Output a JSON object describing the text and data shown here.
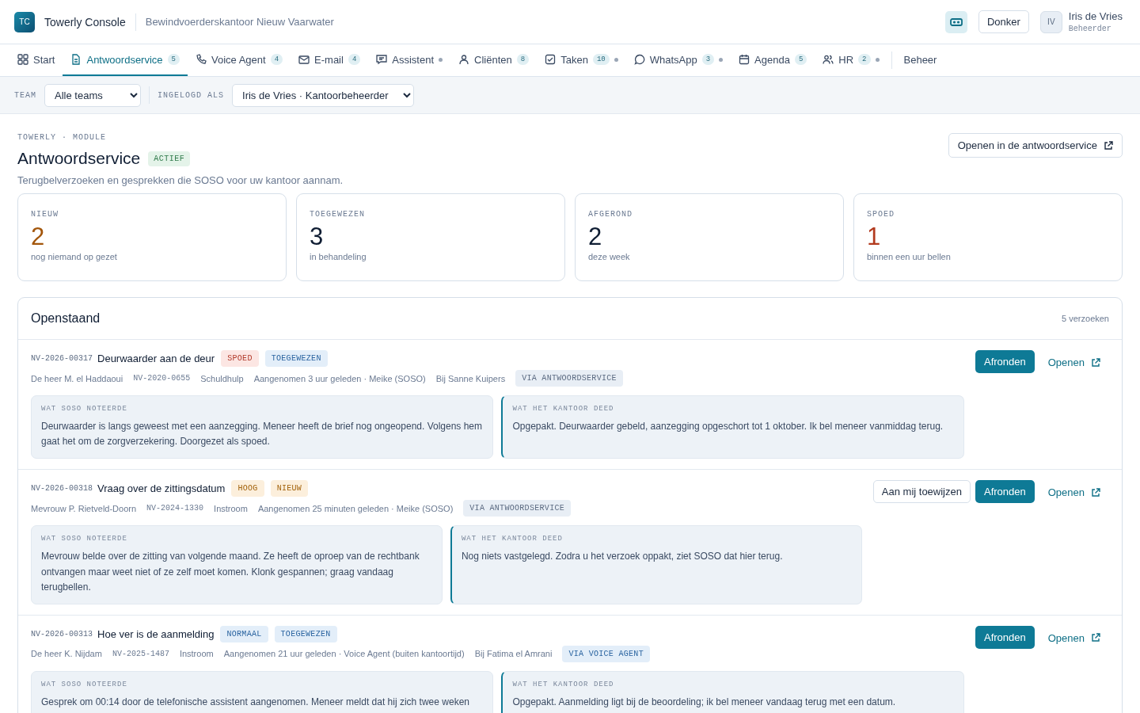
{
  "app": {
    "logo": "TC",
    "name": "Towerly Console",
    "office": "Bewindvoerderskantoor Nieuw Vaarwater",
    "theme_button": "Donker",
    "user": {
      "initials": "IV",
      "name": "Iris de Vries",
      "role": "Beheerder"
    }
  },
  "tabs": [
    {
      "label": "Start",
      "selected": false
    },
    {
      "label": "Antwoordservice",
      "badge": "5",
      "selected": true
    },
    {
      "label": "Voice Agent",
      "badge": "4",
      "selected": false
    },
    {
      "label": "E-mail",
      "badge": "4",
      "selected": false
    },
    {
      "label": "Assistent",
      "dot": true,
      "selected": false
    },
    {
      "label": "Cliënten",
      "badge": "8",
      "selected": false
    },
    {
      "label": "Taken",
      "badge": "10",
      "dot": true,
      "selected": false
    },
    {
      "label": "WhatsApp",
      "badge": "3",
      "dot": true,
      "selected": false
    },
    {
      "label": "Agenda",
      "badge": "5",
      "selected": false
    },
    {
      "label": "HR",
      "badge": "2",
      "dot": true,
      "selected": false
    }
  ],
  "admin_tab": "Beheer",
  "filters": [
    {
      "label": "TEAM",
      "value": "Alle teams"
    },
    {
      "label": "INGELOGD ALS",
      "value": "Iris de Vries · Kantoorbeheerder"
    }
  ],
  "page": {
    "eyebrow": "TOWERLY · MODULE",
    "title": "Antwoordservice",
    "status": "ACTIEF",
    "subtitle": "Terugbelverzoeken en gesprekken die SOSO voor uw kantoor aannam.",
    "open_button": "Openen in de antwoordservice"
  },
  "stats": [
    {
      "label": "NIEUW",
      "value": "2",
      "note": "nog niemand op gezet",
      "kind": "warning"
    },
    {
      "label": "TOEGEWEZEN",
      "value": "3",
      "note": "in behandeling",
      "kind": "plain"
    },
    {
      "label": "AFGEROND",
      "value": "2",
      "note": "deze week",
      "kind": "plain"
    },
    {
      "label": "SPOED",
      "value": "1",
      "note": "binnen een uur bellen",
      "kind": "danger"
    }
  ],
  "list": {
    "title": "Openstaand",
    "count": "5 verzoeken",
    "requests": [
      {
        "ref": "NV-2026-00317",
        "title": "Deurwaarder aan de deur",
        "tags": [
          {
            "text": "SPOED",
            "kind": "urgent"
          },
          {
            "text": "TOEGEWEZEN",
            "kind": "assigned"
          }
        ],
        "client": "De heer M. el Haddaoui",
        "dossier": "NV-2020-0655",
        "category": "Schuldhulp",
        "received": "Aangenomen 3 uur geleden · Meike (SOSO)",
        "handler": "Bij Sanne Kuipers",
        "source": {
          "text": "VIA ANTWOORDSERVICE",
          "kind": "service"
        },
        "actions": [
          "Afronden",
          "Openen"
        ],
        "notes": [
          {
            "label": "WAT SOSO NOTEERDE",
            "text": "Deurwaarder is langs geweest met een aanzegging. Meneer heeft de brief nog ongeopend. Volgens hem gaat het om de zorgverzekering. Doorgezet als spoed."
          },
          {
            "label": "WAT HET KANTOOR DEED",
            "text": "Opgepakt. Deurwaarder gebeld, aanzegging opgeschort tot 1 oktober. Ik bel meneer vanmiddag terug."
          }
        ]
      },
      {
        "ref": "NV-2026-00318",
        "title": "Vraag over de zittingsdatum",
        "tags": [
          {
            "text": "HOOG",
            "kind": "high"
          },
          {
            "text": "NIEUW",
            "kind": "new"
          }
        ],
        "client": "Mevrouw P. Rietveld-Doorn",
        "dossier": "NV-2024-1330",
        "category": "Instroom",
        "received": "Aangenomen 25 minuten geleden · Meike (SOSO)",
        "source": {
          "text": "VIA ANTWOORDSERVICE",
          "kind": "service"
        },
        "assign_button": "Aan mij toewijzen",
        "actions": [
          "Afronden",
          "Openen"
        ],
        "notes": [
          {
            "label": "WAT SOSO NOTEERDE",
            "text": "Mevrouw belde over de zitting van volgende maand. Ze heeft de oproep van de rechtbank ontvangen maar weet niet of ze zelf moet komen. Klonk gespannen; graag vandaag terugbellen."
          },
          {
            "label": "WAT HET KANTOOR DEED",
            "text": "Nog niets vastgelegd. Zodra u het verzoek oppakt, ziet SOSO dat hier terug."
          }
        ]
      },
      {
        "ref": "NV-2026-00313",
        "title": "Hoe ver is de aanmelding",
        "tags": [
          {
            "text": "NORMAAL",
            "kind": "normal"
          },
          {
            "text": "TOEGEWEZEN",
            "kind": "assigned"
          }
        ],
        "client": "De heer K. Nijdam",
        "dossier": "NV-2025-1487",
        "category": "Instroom",
        "received": "Aangenomen 21 uur geleden · Voice Agent (buiten kantoortijd)",
        "handler": "Bij Fatima el Amrani",
        "source": {
          "text": "VIA VOICE AGENT",
          "kind": "voice"
        },
        "actions": [
          "Afronden",
          "Openen"
        ],
        "notes": [
          {
            "label": "WAT SOSO NOTEERDE",
            "text": "Gesprek om 00:14 door de telefonische assistent aangenomen. Meneer meldt dat hij zich twee weken"
          },
          {
            "label": "WAT HET KANTOOR DEED",
            "text": "Opgepakt. Aanmelding ligt bij de beoordeling; ik bel meneer vandaag terug met een datum."
          }
        ]
      }
    ]
  }
}
